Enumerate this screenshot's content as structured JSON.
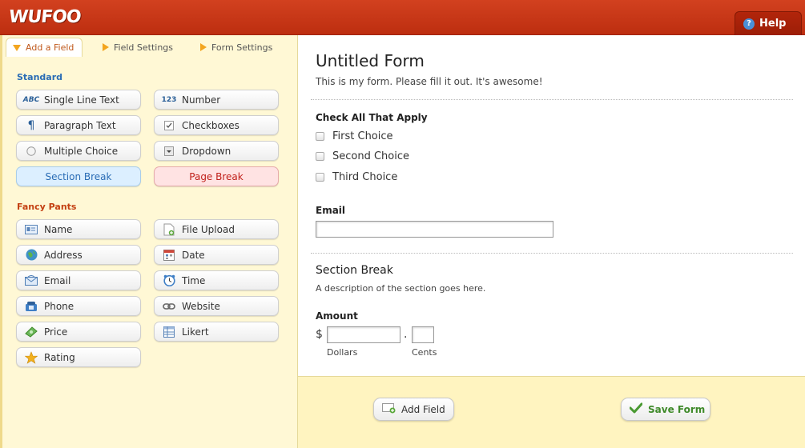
{
  "app": {
    "logo_text": "WUFOO",
    "help_label": "Help"
  },
  "tabs": [
    {
      "label": "Add a Field",
      "active": true
    },
    {
      "label": "Field Settings",
      "active": false
    },
    {
      "label": "Form Settings",
      "active": false
    }
  ],
  "standard": {
    "title": "Standard",
    "items": [
      {
        "label": "Single Line Text",
        "icon": "abc-icon"
      },
      {
        "label": "Number",
        "icon": "number-icon"
      },
      {
        "label": "Paragraph Text",
        "icon": "paragraph-icon"
      },
      {
        "label": "Checkboxes",
        "icon": "checkbox-icon"
      },
      {
        "label": "Multiple Choice",
        "icon": "radio-icon"
      },
      {
        "label": "Dropdown",
        "icon": "dropdown-icon"
      },
      {
        "label": "Section Break",
        "icon": ""
      },
      {
        "label": "Page Break",
        "icon": ""
      }
    ]
  },
  "fancy": {
    "title": "Fancy Pants",
    "items": [
      {
        "label": "Name",
        "icon": "name-card-icon"
      },
      {
        "label": "File Upload",
        "icon": "file-upload-icon"
      },
      {
        "label": "Address",
        "icon": "globe-icon"
      },
      {
        "label": "Date",
        "icon": "calendar-icon"
      },
      {
        "label": "Email",
        "icon": "envelope-icon"
      },
      {
        "label": "Time",
        "icon": "clock-icon"
      },
      {
        "label": "Phone",
        "icon": "phone-icon"
      },
      {
        "label": "Website",
        "icon": "link-icon"
      },
      {
        "label": "Price",
        "icon": "money-icon"
      },
      {
        "label": "Likert",
        "icon": "table-icon"
      },
      {
        "label": "Rating",
        "icon": "star-icon"
      }
    ]
  },
  "form": {
    "title": "Untitled Form",
    "description": "This is my form. Please fill it out. It's awesome!",
    "checkbox_label": "Check All That Apply",
    "choices": [
      "First Choice",
      "Second Choice",
      "Third Choice"
    ],
    "email_label": "Email",
    "email_value": "",
    "section_title": "Section Break",
    "section_desc": "A description of the section goes here.",
    "amount_label": "Amount",
    "currency": "$",
    "decimal": ".",
    "dollars_label": "Dollars",
    "cents_label": "Cents"
  },
  "footer": {
    "add_field_label": "Add Field",
    "save_form_label": "Save Form"
  },
  "colors": {
    "header": "#c8381a",
    "sidebar_bg": "#fff8d5",
    "standard_title": "#2a6cb5",
    "fancy_title": "#c44113",
    "save_green": "#3f8a2a"
  }
}
